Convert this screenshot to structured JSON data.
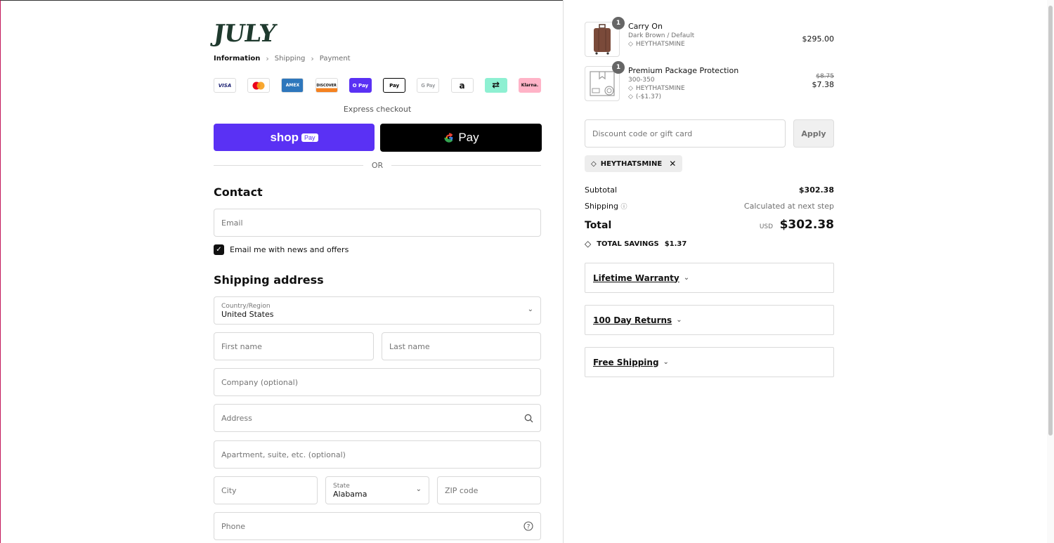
{
  "brand": {
    "logo_text": "JULY"
  },
  "breadcrumb": [
    {
      "label": "Information",
      "active": true
    },
    {
      "label": "Shipping",
      "active": false
    },
    {
      "label": "Payment",
      "active": false
    }
  ],
  "payment_icons": [
    "VISA",
    "MC",
    "AMEX",
    "DISCOVER",
    "O Pay",
    "Pay",
    "G Pay",
    "a",
    "⇄",
    "Klarna."
  ],
  "express": {
    "label": "Express checkout",
    "shop_pay": "shop",
    "shop_pay_badge": "Pay",
    "gpay": "Pay",
    "or": "OR"
  },
  "contact": {
    "title": "Contact",
    "email_placeholder": "Email",
    "newsletter_label": "Email me with news and offers"
  },
  "shipping": {
    "title": "Shipping address",
    "country_label": "Country/Region",
    "country_value": "United States",
    "first_name_placeholder": "First name",
    "last_name_placeholder": "Last name",
    "company_placeholder": "Company (optional)",
    "address_placeholder": "Address",
    "apartment_placeholder": "Apartment, suite, etc. (optional)",
    "city_placeholder": "City",
    "state_label": "State",
    "state_value": "Alabama",
    "zip_placeholder": "ZIP code",
    "phone_placeholder": "Phone"
  },
  "cart": {
    "items": [
      {
        "name": "Carry On",
        "variant": "Dark Brown / Default",
        "code": "HEYTHATSMINE",
        "qty": "1",
        "price": "$295.00"
      },
      {
        "name": "Premium Package Protection",
        "variant": "300-350",
        "code": "HEYTHATSMINE",
        "discount": "(-$1.37)",
        "qty": "1",
        "original_price": "$8.75",
        "price": "$7.38"
      }
    ],
    "discount_placeholder": "Discount code or gift card",
    "apply_label": "Apply",
    "applied_code": "HEYTHATSMINE",
    "subtotal_label": "Subtotal",
    "subtotal_value": "$302.38",
    "shipping_label": "Shipping",
    "shipping_value": "Calculated at next step",
    "total_label": "Total",
    "currency": "USD",
    "total_value": "$302.38",
    "savings_label": "TOTAL SAVINGS",
    "savings_value": "$1.37"
  },
  "accordions": [
    {
      "label": "Lifetime Warranty"
    },
    {
      "label": "100 Day Returns"
    },
    {
      "label": "Free Shipping"
    }
  ],
  "colors": {
    "shop_pay": "#5a31f4",
    "logo": "#1f3a2e"
  }
}
